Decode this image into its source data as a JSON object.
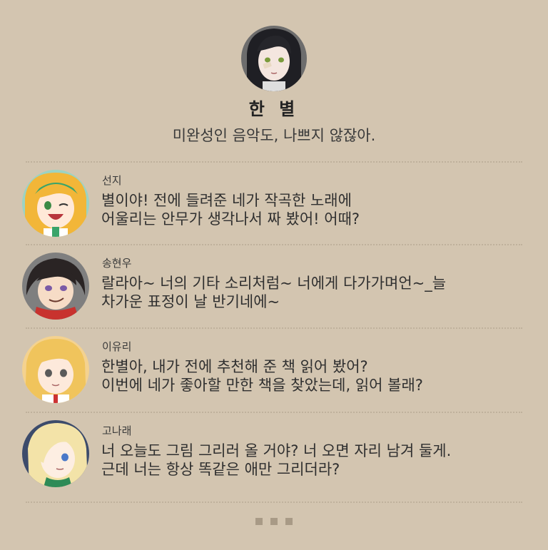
{
  "profile": {
    "name": "한 별",
    "status": "미완성인 음악도, 나쁘지 않잖아."
  },
  "comments": [
    {
      "author": "선지",
      "lines": [
        "별이야! 전에 들려준 네가 작곡한 노래에",
        "어울리는 안무가 생각나서 짜 봤어! 어때?"
      ]
    },
    {
      "author": "송현우",
      "lines": [
        "랄라아~ 너의 기타 소리처럼~ 너에게 다가가며언~_늘",
        "차가운 표정이 날 반기네에~"
      ]
    },
    {
      "author": "이유리",
      "lines": [
        "한별아, 내가 전에 추천해 준 책 읽어 봤어?",
        "이번에 네가 좋아할 만한 책을 찾았는데, 읽어 볼래?"
      ]
    },
    {
      "author": "고나래",
      "lines": [
        "너 오늘도 그림 그리러 올 거야? 너 오면 자리 남겨 둘게.",
        "근데 너는 항상 똑같은 애만 그리더라?"
      ]
    }
  ],
  "colors": {
    "background": "#d3c5b0",
    "text": "#2f2f2f",
    "divider": "#bfb19c"
  }
}
